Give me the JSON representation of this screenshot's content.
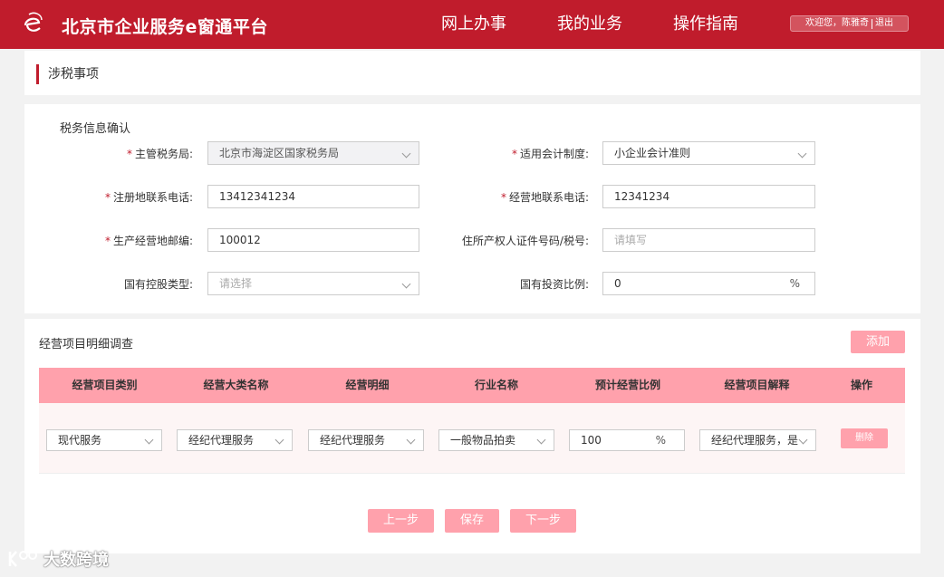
{
  "header": {
    "title": "北京市企业服务e窗通平台",
    "nav": [
      "网上办事",
      "我的业务",
      "操作指南"
    ],
    "welcome": "欢迎您，陈雅奇",
    "logout": "退出",
    "brand_color": "#c01c2c"
  },
  "page": {
    "section_title": "涉税事项"
  },
  "tax_info": {
    "group_title": "税务信息确认",
    "authority": {
      "label": "主管税务局:",
      "value": "北京市海淀区国家税务局",
      "required": true
    },
    "accounting": {
      "label": "适用会计制度:",
      "value": "小企业会计准则",
      "required": true
    },
    "reg_phone": {
      "label": "注册地联系电话:",
      "value": "13412341234",
      "required": true
    },
    "biz_phone": {
      "label": "经营地联系电话:",
      "value": "12341234",
      "required": true
    },
    "postcode": {
      "label": "生产经营地邮编:",
      "value": "100012",
      "required": true
    },
    "owner_id": {
      "label": "住所产权人证件号码/税号:",
      "placeholder": "请填写"
    },
    "state_type": {
      "label": "国有控股类型:",
      "placeholder": "请选择"
    },
    "state_ratio": {
      "label": "国有投资比例:",
      "value": "0",
      "unit": "%"
    }
  },
  "business": {
    "group_title": "经营项目明细调查",
    "add_label": "添加",
    "columns": [
      "经营项目类别",
      "经营大类名称",
      "经营明细",
      "行业名称",
      "预计经营比例",
      "经营项目解释",
      "操作"
    ],
    "rows": [
      {
        "category": "现代服务",
        "major": "经纪代理服务",
        "detail": "经纪代理服务",
        "industry": "一般物品拍卖",
        "ratio": "100",
        "unit": "%",
        "explain": "经纪代理服务，是",
        "action": "删除"
      }
    ]
  },
  "footer": {
    "prev": "上一步",
    "save": "保存",
    "next": "下一步"
  },
  "watermark": "大数跨境",
  "accent_color": "#ffa1ac"
}
